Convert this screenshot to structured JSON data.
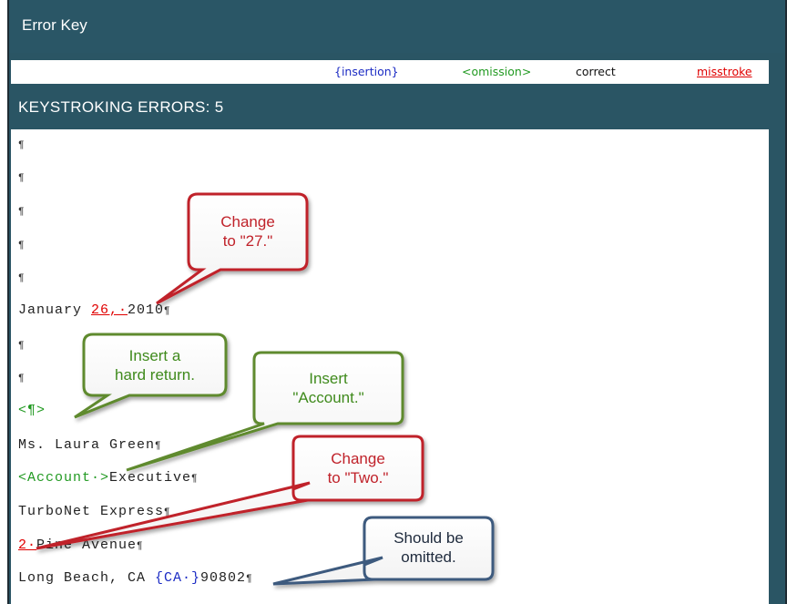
{
  "window": {
    "title": "Error Key"
  },
  "legend": {
    "insertion": "{insertion}",
    "omission": "<omission>",
    "correct": "correct",
    "misstroke": "misstroke"
  },
  "section": {
    "header": "KEYSTROKING ERRORS: 5"
  },
  "pilcrow": "¶",
  "document": {
    "date_prefix": "January ",
    "date_misstroke": "26,·",
    "date_suffix": "2010",
    "hard_return_omission": "<¶>",
    "name_line": "Ms. Laura Green",
    "account_omission": "<Account·>",
    "executive_text": "Executive",
    "company_line": "TurboNet Express",
    "street_misstroke": "2·",
    "street_text": "Pine Avenue",
    "city_prefix": "Long Beach, CA ",
    "city_insertion": "{CA·}",
    "zip": "90802"
  },
  "callouts": {
    "change_27": {
      "line1": "Change",
      "line2": "to \"27.\""
    },
    "insert_hard_return": {
      "line1": "Insert a",
      "line2": "hard return."
    },
    "insert_account": {
      "line1": "Insert",
      "line2": "\"Account.\""
    },
    "change_two": {
      "line1": "Change",
      "line2": "to \"Two.\""
    },
    "should_be_omitted": {
      "line1": "Should be",
      "line2": "omitted."
    }
  },
  "colors": {
    "header_bg": "#2a5666",
    "insertion": "#1c2cc4",
    "omission": "#229a22",
    "misstroke": "#e00000",
    "callout_red": "#c0222a",
    "callout_green": "#5e8a2e",
    "callout_blue": "#3e5a7e"
  }
}
